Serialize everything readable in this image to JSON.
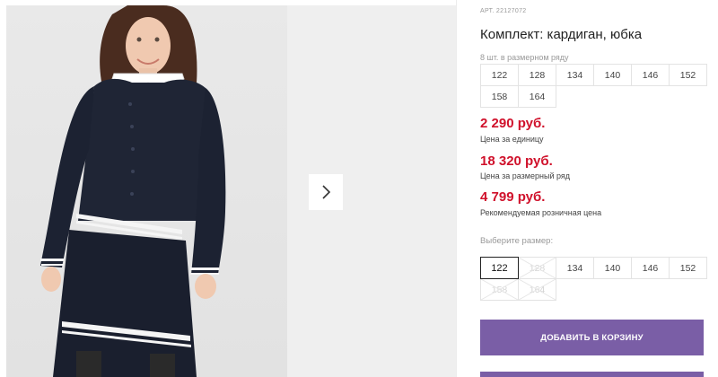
{
  "product": {
    "article": "АРТ. 22127072",
    "title": "Комплект: кардиган, юбка",
    "row_note": "8 шт. в размерном ряду"
  },
  "size_row": [
    "122",
    "128",
    "134",
    "140",
    "146",
    "152",
    "158",
    "164"
  ],
  "prices": [
    {
      "value": "2 290 руб.",
      "label": "Цена за единицу"
    },
    {
      "value": "18 320 руб.",
      "label": "Цена за размерный ряд"
    },
    {
      "value": "4 799 руб.",
      "label": "Рекомендуемая розничная цена"
    }
  ],
  "size_picker": {
    "label": "Выберите размер:",
    "sizes": [
      {
        "label": "122",
        "state": "selected"
      },
      {
        "label": "128",
        "state": "disabled"
      },
      {
        "label": "134",
        "state": "available"
      },
      {
        "label": "140",
        "state": "available"
      },
      {
        "label": "146",
        "state": "available"
      },
      {
        "label": "152",
        "state": "available"
      },
      {
        "label": "158",
        "state": "disabled"
      },
      {
        "label": "164",
        "state": "disabled"
      }
    ]
  },
  "cart_button": "ДОБАВИТЬ В КОРЗИНУ",
  "colors": {
    "price": "#d0112b",
    "button": "#7a5ea6",
    "outfit": "#1f2535"
  },
  "icons": {
    "next": "chevron-right-icon"
  }
}
